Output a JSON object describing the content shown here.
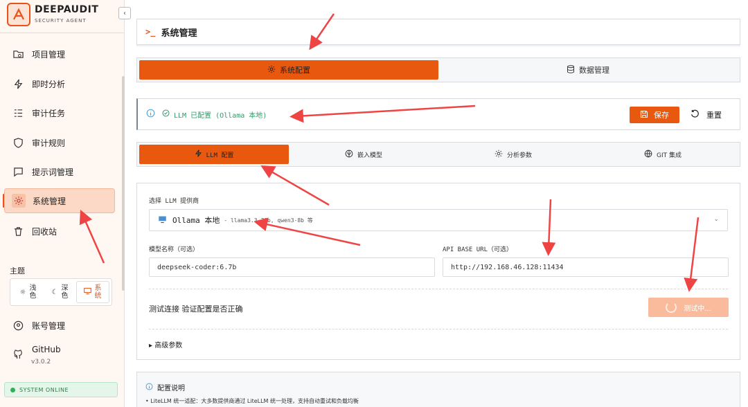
{
  "brand": {
    "name": "DEEPAUDIT",
    "subtitle": "SECURITY AGENT",
    "collapse": "‹"
  },
  "sidebar": {
    "items": [
      {
        "label": "项目管理",
        "icon": "folder-search-icon"
      },
      {
        "label": "即时分析",
        "icon": "lightning-icon"
      },
      {
        "label": "审计任务",
        "icon": "list-check-icon"
      },
      {
        "label": "审计规则",
        "icon": "shield-icon"
      },
      {
        "label": "提示词管理",
        "icon": "message-icon"
      },
      {
        "label": "系统管理",
        "icon": "gear-icon",
        "active": true
      },
      {
        "label": "回收站",
        "icon": "trash-icon"
      }
    ],
    "theme_label": "主题",
    "theme_options": [
      {
        "label": "浅色",
        "icon": "sun-icon"
      },
      {
        "label": "深色",
        "icon": "moon-icon"
      },
      {
        "label": "系统",
        "icon": "monitor-icon",
        "active": true
      }
    ],
    "account": "账号管理",
    "github": "GitHub",
    "version": "v3.0.2",
    "status": "SYSTEM ONLINE"
  },
  "header": {
    "prompt": ">_",
    "title": "系统管理"
  },
  "top_tabs": [
    {
      "label": "系统配置",
      "icon": "gear-icon",
      "active": true
    },
    {
      "label": "数据管理",
      "icon": "database-icon"
    }
  ],
  "status_bar": {
    "message": "LLM 已配置 (Ollama 本地)",
    "save": "保存",
    "reset": "重置"
  },
  "sub_tabs": [
    {
      "label": "LLM 配置",
      "icon": "lightning-icon",
      "active": true
    },
    {
      "label": "嵌入模型",
      "icon": "brain-icon"
    },
    {
      "label": "分析参数",
      "icon": "gear-icon"
    },
    {
      "label": "GIT 集成",
      "icon": "globe-icon"
    }
  ],
  "llm_config": {
    "provider_label": "选择 LLM 提供商",
    "provider_value": "Ollama 本地",
    "provider_hint": "- llama3.3-70b, qwen3-8b 等",
    "model_label": "模型名称（可选）",
    "model_value": "deepseek-coder:6.7b",
    "base_url_label": "API BASE URL（可选）",
    "base_url_value": "http://192.168.46.128:11434",
    "test_label": "测试连接 验证配置是否正确",
    "test_button": "测试中...",
    "advanced": "▸ 高级参数"
  },
  "notes": {
    "title": "配置说明",
    "item": "• LiteLLM 统一适配：大多数提供商通过 LiteLLM 统一处理，支持自动重试和负载均衡"
  },
  "colors": {
    "accent": "#e8580f",
    "success": "#2f9a6a",
    "annotation": "#ef4444"
  }
}
